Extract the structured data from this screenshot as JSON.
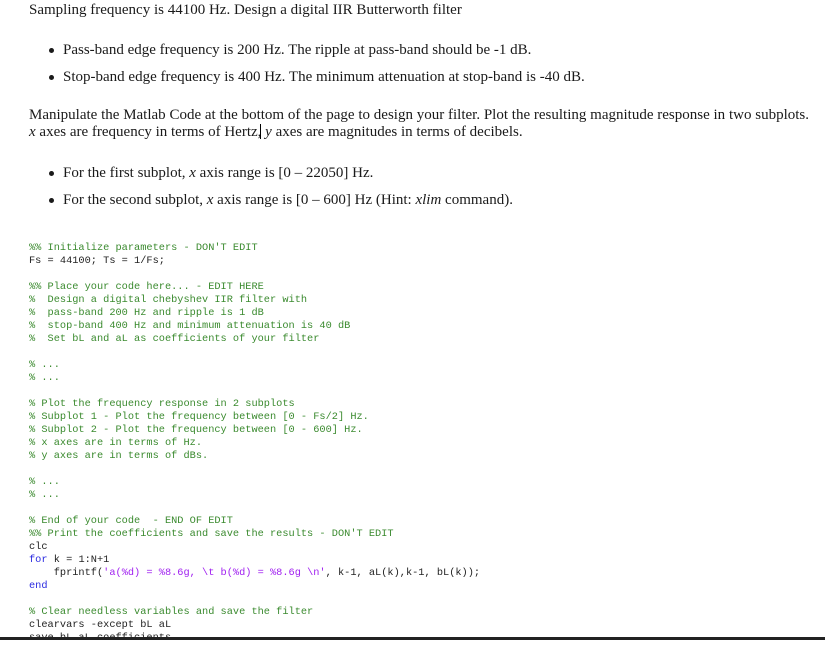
{
  "title": "Sampling frequency is 44100 Hz. Design a digital IIR Butterworth filter",
  "spec_bullets": [
    "Pass-band edge frequency is 200 Hz. The ripple at pass-band should be -1 dB.",
    "Stop-band edge frequency is 400 Hz. The minimum attenuation at stop-band is -40 dB."
  ],
  "instructions": {
    "part1": "Manipulate the Matlab Code at the bottom of the page to design your filter. Plot the resulting magnitude response in two subplots. ",
    "x_var": "x",
    "part2": " axes are frequency in terms of Hertz,",
    "y_var": "y",
    "part3": " axes are magnitudes in terms of decibels."
  },
  "plot_bullets": [
    {
      "pre": "For the first subplot, ",
      "var": "x",
      "post": " axis range is [0 – 22050] Hz.",
      "hint_pre": "",
      "hint_cmd": "",
      "hint_post": ""
    },
    {
      "pre": "For the second subplot, ",
      "var": "x",
      "post": " axis range is [0 – 600] Hz (Hint: ",
      "hint_cmd": "xlim",
      "hint_post": " command)."
    }
  ],
  "code": {
    "lines": [
      [
        {
          "t": "cm",
          "v": "%% Initialize parameters - DON'T EDIT"
        }
      ],
      [
        {
          "t": "",
          "v": "Fs = 44100; Ts = 1/Fs;"
        }
      ],
      [],
      [
        {
          "t": "cm",
          "v": "%% Place your code here... - EDIT HERE"
        }
      ],
      [
        {
          "t": "cm",
          "v": "%  Design a digital chebyshev IIR filter with"
        }
      ],
      [
        {
          "t": "cm",
          "v": "%  pass-band 200 Hz and ripple is 1 dB"
        }
      ],
      [
        {
          "t": "cm",
          "v": "%  stop-band 400 Hz and minimum attenuation is 40 dB"
        }
      ],
      [
        {
          "t": "cm",
          "v": "%  Set bL and aL as coefficients of your filter"
        }
      ],
      [],
      [
        {
          "t": "cm",
          "v": "% ..."
        }
      ],
      [
        {
          "t": "cm",
          "v": "% ..."
        }
      ],
      [],
      [
        {
          "t": "cm",
          "v": "% Plot the frequency response in 2 subplots"
        }
      ],
      [
        {
          "t": "cm",
          "v": "% Subplot 1 - Plot the frequency between [0 - Fs/2] Hz."
        }
      ],
      [
        {
          "t": "cm",
          "v": "% Subplot 2 - Plot the frequency between [0 - 600] Hz."
        }
      ],
      [
        {
          "t": "cm",
          "v": "% x axes are in terms of Hz."
        }
      ],
      [
        {
          "t": "cm",
          "v": "% y axes are in terms of dBs."
        }
      ],
      [],
      [
        {
          "t": "cm",
          "v": "% ..."
        }
      ],
      [
        {
          "t": "cm",
          "v": "% ..."
        }
      ],
      [],
      [
        {
          "t": "cm",
          "v": "% End of your code  - END OF EDIT"
        }
      ],
      [
        {
          "t": "cm",
          "v": "%% Print the coefficients and save the results - DON'T EDIT"
        }
      ],
      [
        {
          "t": "",
          "v": "clc"
        }
      ],
      [
        {
          "t": "kw",
          "v": "for"
        },
        {
          "t": "",
          "v": " k = 1:N+1"
        }
      ],
      [
        {
          "t": "",
          "v": "    fprintf("
        },
        {
          "t": "st",
          "v": "'a(%d) = %8.6g, \\t b(%d) = %8.6g \\n'"
        },
        {
          "t": "",
          "v": ", k-1, aL(k),k-1, bL(k));"
        }
      ],
      [
        {
          "t": "kw",
          "v": "end"
        }
      ],
      [],
      [
        {
          "t": "cm",
          "v": "% Clear needless variables and save the filter"
        }
      ],
      [
        {
          "t": "",
          "v": "clearvars -except bL aL"
        }
      ],
      [
        {
          "t": "",
          "v": "save bL aL coefficients"
        }
      ]
    ]
  }
}
